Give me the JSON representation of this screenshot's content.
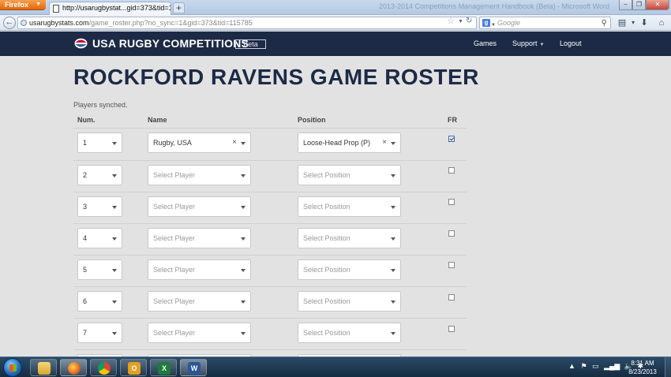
{
  "browser": {
    "menu_button": "Firefox",
    "tab_title": "http://usarugbystat...gid=373&tid=115785",
    "background_title": "2013-2014 Competitions Management Handbook (Beta) - Microsoft Word",
    "url_domain": "usarugbystats.com",
    "url_path": "/game_roster.php?no_sync=1&gid=373&tid=115785",
    "search_placeholder": "Google",
    "search_engine_letter": "g"
  },
  "site": {
    "brand": "USA RUGBY COMPETITIONS",
    "beta": "Beta",
    "nav": {
      "games": "Games",
      "support": "Support",
      "logout": "Logout"
    }
  },
  "page": {
    "title": "ROCKFORD RAVENS GAME ROSTER",
    "sync_message": "Players synched.",
    "columns": {
      "num": "Num.",
      "name": "Name",
      "position": "Position",
      "fr": "FR"
    }
  },
  "roster": [
    {
      "num": "1",
      "name": "Rugby, USA",
      "position": "Loose-Head Prop (P)",
      "fr": true
    },
    {
      "num": "2",
      "name": "Select Player",
      "position": "Select Position",
      "fr": false
    },
    {
      "num": "3",
      "name": "Select Player",
      "position": "Select Position",
      "fr": false
    },
    {
      "num": "4",
      "name": "Select Player",
      "position": "Select Position",
      "fr": false
    },
    {
      "num": "5",
      "name": "Select Player",
      "position": "Select Position",
      "fr": false
    },
    {
      "num": "6",
      "name": "Select Player",
      "position": "Select Position",
      "fr": false
    },
    {
      "num": "7",
      "name": "Select Player",
      "position": "Select Position",
      "fr": false
    }
  ],
  "taskbar": {
    "outlook_letter": "O",
    "excel_letter": "X",
    "word_letter": "W",
    "clock_time": "8:31 AM",
    "clock_date": "8/23/2013"
  },
  "colors": {
    "header_navy": "#1c2a46",
    "page_bg": "#e2e2e2",
    "title_navy": "#1c2a46"
  }
}
